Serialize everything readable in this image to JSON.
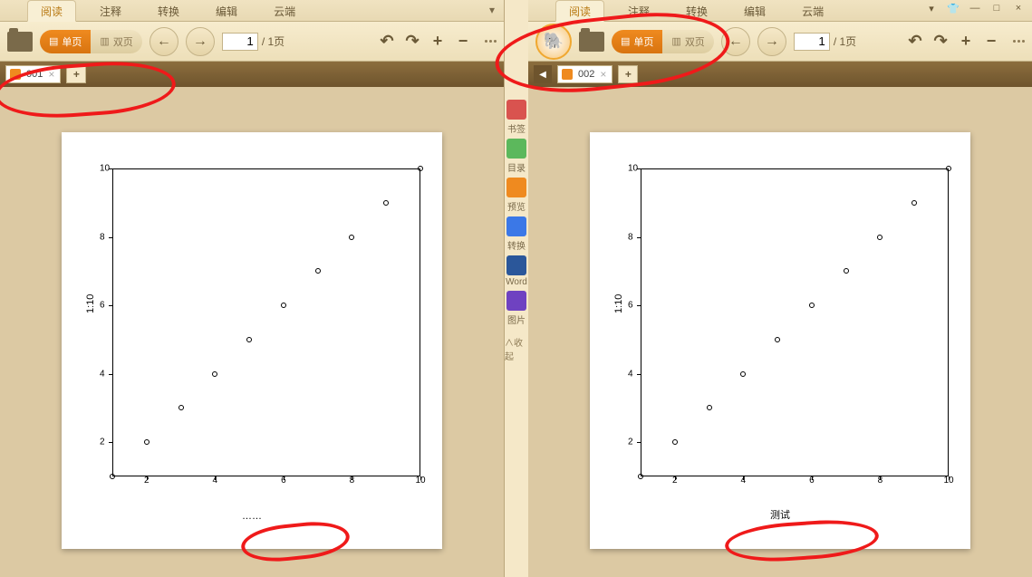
{
  "tabs": {
    "items": [
      "阅读",
      "注释",
      "转换",
      "编辑",
      "云端"
    ],
    "active": 0
  },
  "toolbar": {
    "single_page": "单页",
    "double_page": "双页",
    "page_value": "1",
    "page_total": "/ 1页"
  },
  "left": {
    "doc_tab_name": "001",
    "xlabel": "……"
  },
  "right": {
    "doc_tab_name": "002",
    "xlabel": "测试"
  },
  "sidebar": {
    "items": [
      {
        "label": "书签",
        "color": "#d9534f"
      },
      {
        "label": "目录",
        "color": "#5cb85c"
      },
      {
        "label": "预览",
        "color": "#ef8a1f"
      },
      {
        "label": "转换",
        "color": "#3b78e7"
      },
      {
        "label": "Word",
        "color": "#2b579a"
      },
      {
        "label": "图片",
        "color": "#6f42c1"
      }
    ],
    "collapse": "收起"
  },
  "chart_data": {
    "type": "scatter",
    "title": "",
    "ylabel": "1:10",
    "x_ticks": [
      2,
      4,
      6,
      8,
      10
    ],
    "y_ticks": [
      2,
      4,
      6,
      8,
      10
    ],
    "xlim": [
      1,
      10
    ],
    "ylim": [
      1,
      10
    ],
    "series": [
      {
        "name": "",
        "x": [
          1,
          2,
          3,
          4,
          5,
          6,
          7,
          8,
          9,
          10
        ],
        "y": [
          1,
          2,
          3,
          4,
          5,
          6,
          7,
          8,
          9,
          10
        ]
      }
    ]
  }
}
